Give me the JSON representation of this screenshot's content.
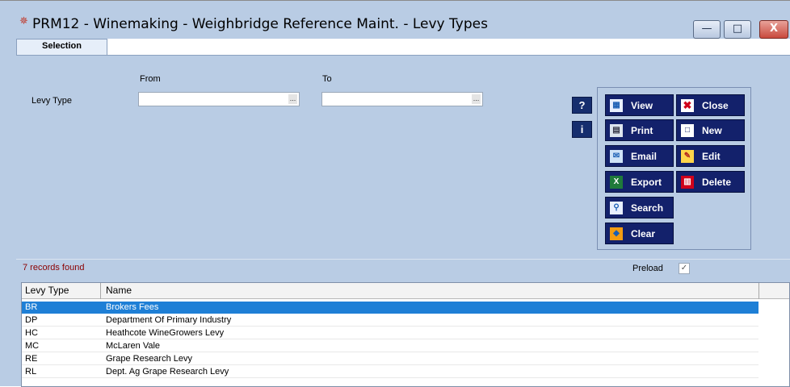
{
  "window": {
    "title": "PRM12 - Winemaking - Weighbridge Reference Maint. - Levy Types",
    "app_icon": "✵",
    "controls": {
      "minimize": "—",
      "maximize": "□",
      "close": "X"
    }
  },
  "tabs": [
    {
      "label": "Selection",
      "active": true
    }
  ],
  "selection": {
    "from_label": "From",
    "to_label": "To",
    "levy_type_label": "Levy Type",
    "from_value": "",
    "to_value": "",
    "ellipsis": "..."
  },
  "help_buttons": {
    "help": "?",
    "info": "i"
  },
  "actions": {
    "view": "View",
    "close": "Close",
    "print": "Print",
    "new": "New",
    "email": "Email",
    "edit": "Edit",
    "export": "Export",
    "delete": "Delete",
    "search": "Search",
    "clear": "Clear"
  },
  "status": {
    "records_found": "7 records found",
    "preload_label": "Preload",
    "preload_checked": true,
    "check_mark": "✓"
  },
  "grid": {
    "columns": [
      "Levy Type",
      "Name"
    ],
    "rows": [
      {
        "code": "BR",
        "name": "Brokers Fees",
        "selected": true
      },
      {
        "code": "DP",
        "name": "Department Of Primary Industry"
      },
      {
        "code": "HC",
        "name": "Heathcote WineGrowers Levy"
      },
      {
        "code": "MC",
        "name": "McLaren Vale"
      },
      {
        "code": "RE",
        "name": "Grape Research Levy"
      },
      {
        "code": "RL",
        "name": "Dept. Ag Grape Research Levy"
      }
    ]
  },
  "colors": {
    "accent": "#13216b",
    "selected_row": "#1e7fd6",
    "background": "#b9cce4",
    "record_count_text": "#8b0000"
  }
}
